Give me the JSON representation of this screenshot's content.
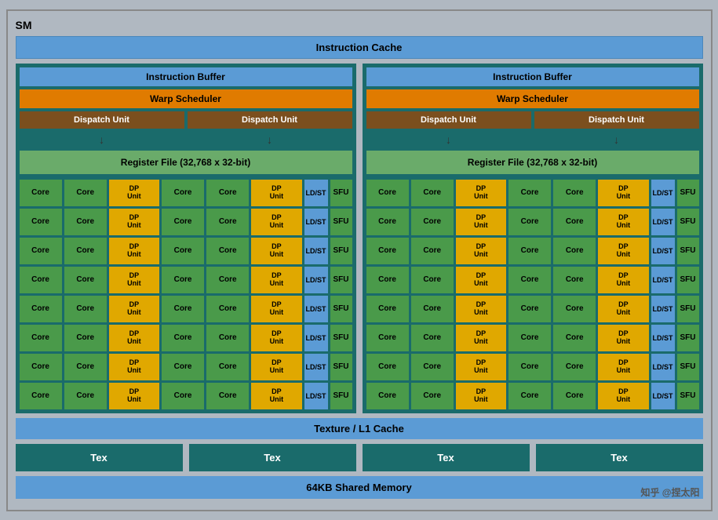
{
  "sm": {
    "title": "SM",
    "instruction_cache": "Instruction Cache",
    "left": {
      "instruction_buffer": "Instruction Buffer",
      "warp_scheduler": "Warp Scheduler",
      "dispatch_unit_1": "Dispatch Unit",
      "dispatch_unit_2": "Dispatch Unit",
      "register_file": "Register File (32,768 x 32-bit)"
    },
    "right": {
      "instruction_buffer": "Instruction Buffer",
      "warp_scheduler": "Warp Scheduler",
      "dispatch_unit_1": "Dispatch Unit",
      "dispatch_unit_2": "Dispatch Unit",
      "register_file": "Register File (32,768 x 32-bit)"
    },
    "core_label": "Core",
    "dp_unit_label": "DP\nUnit",
    "ldst_label": "LD/ST",
    "sfu_label": "SFU",
    "texture_l1": "Texture / L1 Cache",
    "tex_label": "Tex",
    "shared_memory": "64KB Shared Memory",
    "num_rows": 8,
    "watermark": "知乎 @捏太阳"
  }
}
